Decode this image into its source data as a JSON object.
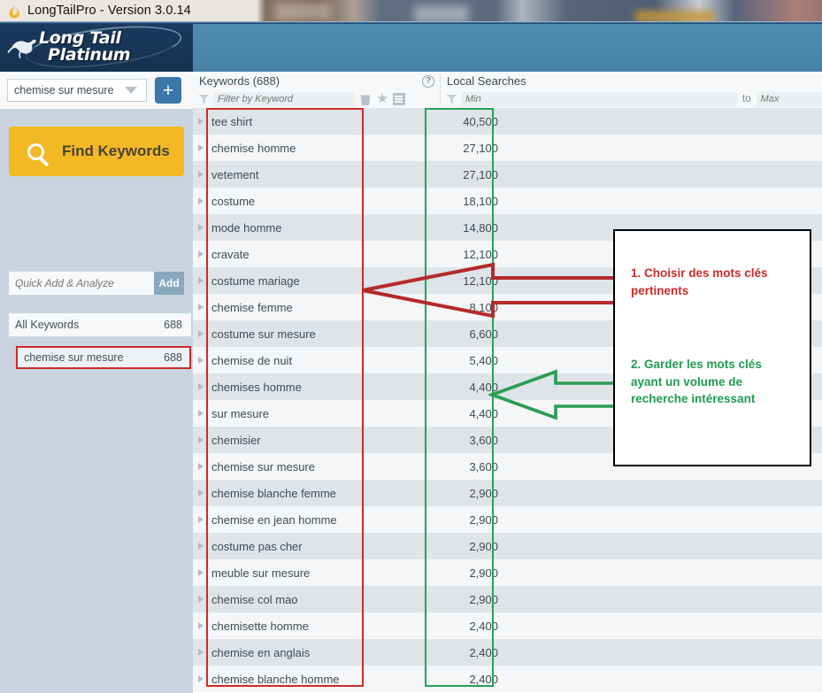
{
  "titlebar": {
    "title": "LongTailPro - Version 3.0.14",
    "app_icon": "flame-icon"
  },
  "header": {
    "logo_line1": "Long Tail",
    "logo_line2": "Platinum"
  },
  "sidebar": {
    "project_select": {
      "value": "chemise sur mesure",
      "icon": "chevron-down-icon"
    },
    "add_project_button": "+",
    "find_keywords_button": "Find Keywords",
    "quick_add": {
      "placeholder": "Quick Add & Analyze",
      "value": "",
      "button": "Add"
    },
    "all_keywords": {
      "label": "All Keywords",
      "count": "688"
    },
    "selected_keyword_group": {
      "label": "chemise sur mesure",
      "count": "688"
    }
  },
  "main": {
    "keywords_column": {
      "title": "Keywords (688)",
      "filter_placeholder": "Filter by Keyword",
      "filter_value": "",
      "help_icon": "question-circle-icon",
      "icons": [
        "trash-icon",
        "star-icon",
        "note-icon"
      ]
    },
    "local_searches_column": {
      "title": "Local Searches",
      "min_placeholder": "Min",
      "min_value": "",
      "max_placeholder": "Max",
      "max_value": "",
      "range_separator": "to"
    },
    "rows": [
      {
        "keyword": "tee shirt",
        "local_searches": "40,500"
      },
      {
        "keyword": "chemise homme",
        "local_searches": "27,100"
      },
      {
        "keyword": "vetement",
        "local_searches": "27,100"
      },
      {
        "keyword": "costume",
        "local_searches": "18,100"
      },
      {
        "keyword": "mode homme",
        "local_searches": "14,800"
      },
      {
        "keyword": "cravate",
        "local_searches": "12,100"
      },
      {
        "keyword": "costume mariage",
        "local_searches": "12,100"
      },
      {
        "keyword": "chemise femme",
        "local_searches": "8,100"
      },
      {
        "keyword": "costume sur mesure",
        "local_searches": "6,600"
      },
      {
        "keyword": "chemise de nuit",
        "local_searches": "5,400"
      },
      {
        "keyword": "chemises homme",
        "local_searches": "4,400"
      },
      {
        "keyword": "sur mesure",
        "local_searches": "4,400"
      },
      {
        "keyword": "chemisier",
        "local_searches": "3,600"
      },
      {
        "keyword": "chemise sur mesure",
        "local_searches": "3,600"
      },
      {
        "keyword": "chemise blanche femme",
        "local_searches": "2,900"
      },
      {
        "keyword": "chemise en jean homme",
        "local_searches": "2,900"
      },
      {
        "keyword": "costume pas cher",
        "local_searches": "2,900"
      },
      {
        "keyword": "meuble sur mesure",
        "local_searches": "2,900"
      },
      {
        "keyword": "chemise col mao",
        "local_searches": "2,900"
      },
      {
        "keyword": "chemisette homme",
        "local_searches": "2,400"
      },
      {
        "keyword": "chemise en anglais",
        "local_searches": "2,400"
      },
      {
        "keyword": "chemise blanche homme",
        "local_searches": "2,400"
      }
    ]
  },
  "annotations": {
    "note_1": "1. Choisir des mots clés pertinents",
    "note_2": "2. Garder les mots clés ayant un volume de recherche intéressant",
    "color_red": "#cc2a2a",
    "color_green": "#23a455"
  }
}
